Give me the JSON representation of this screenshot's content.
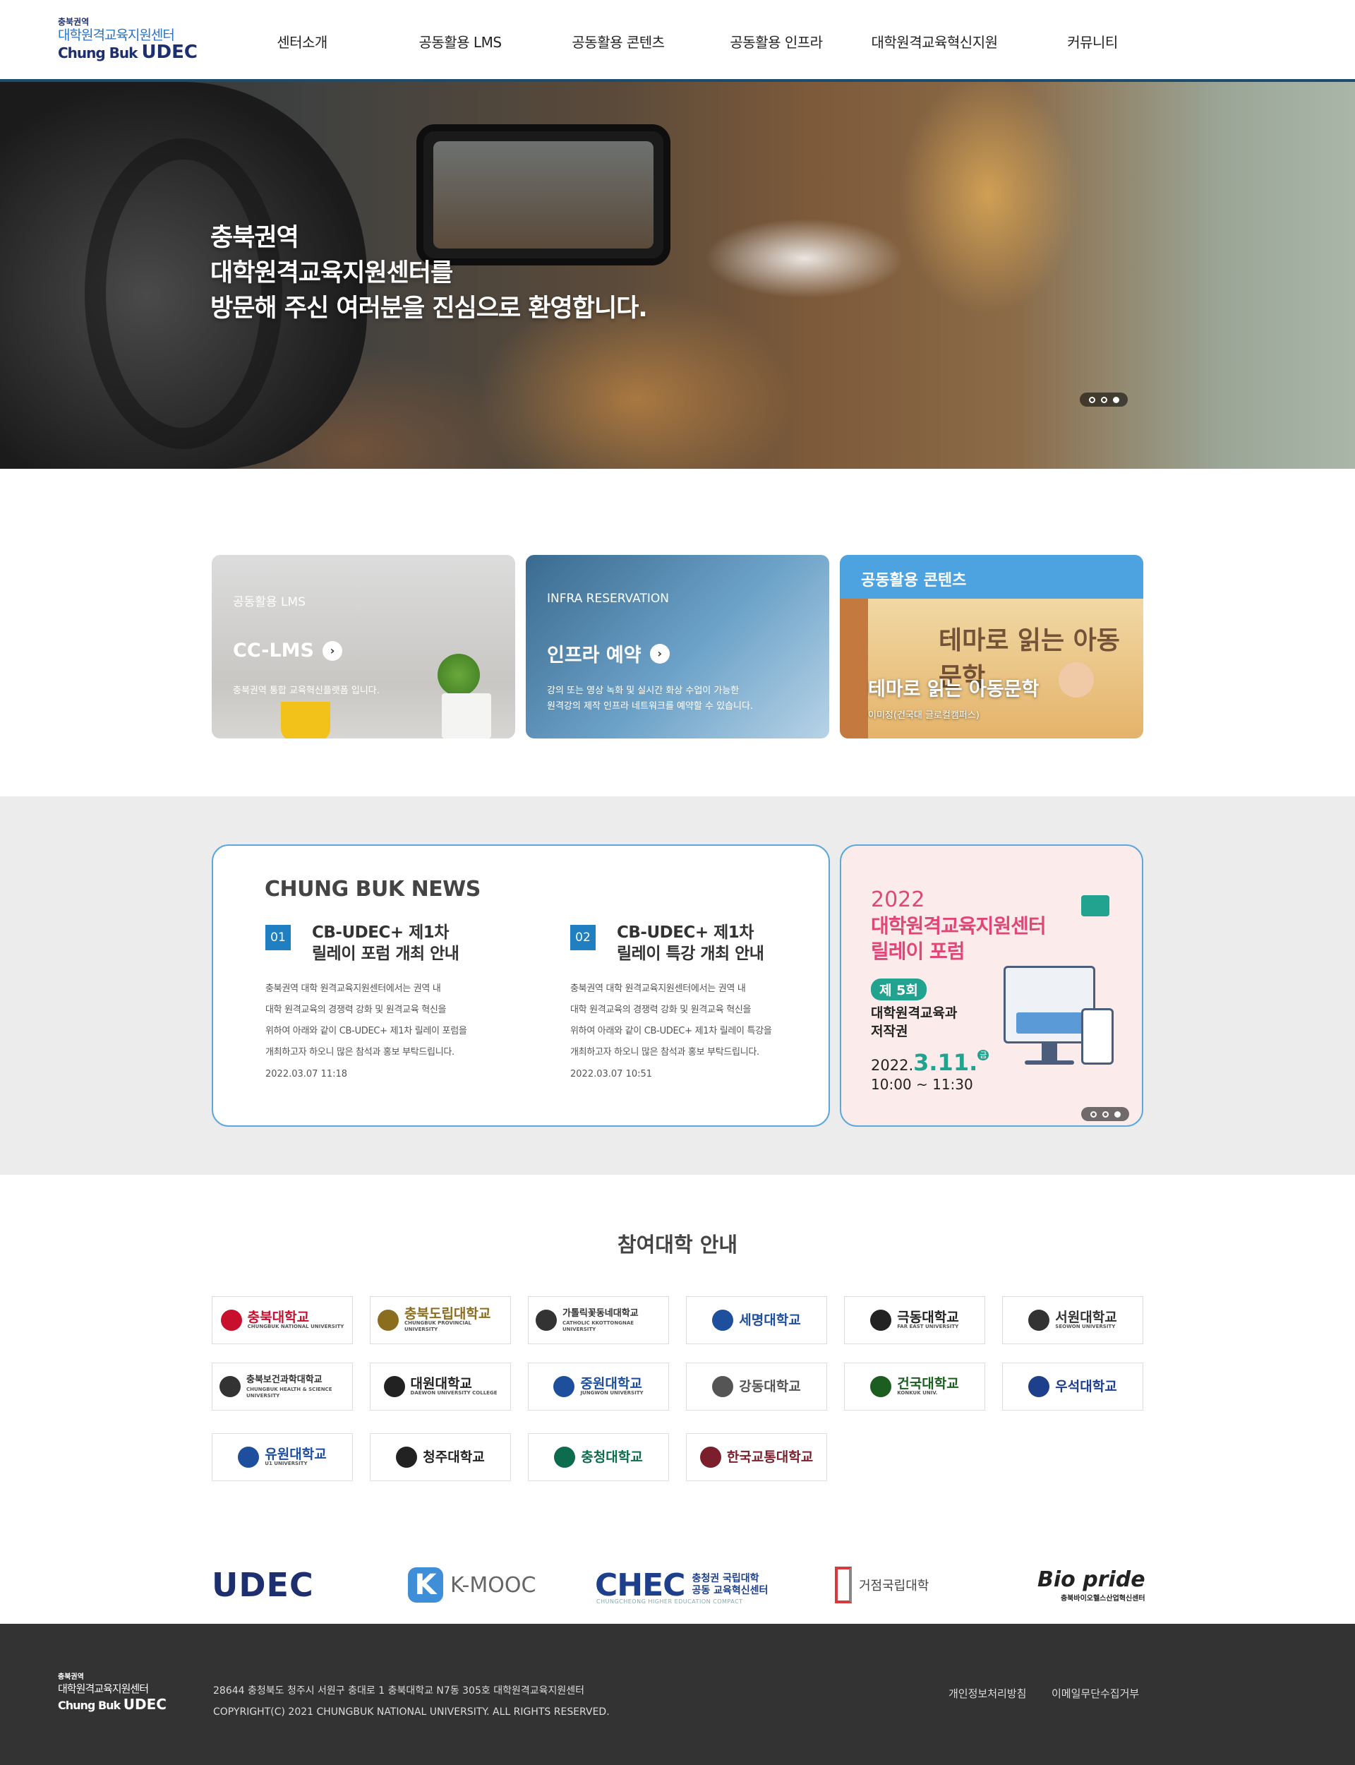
{
  "header": {
    "logo": {
      "line1": "충북권역",
      "line2": "대학원격교육지원센터",
      "line3_a": "Chung Buk",
      "line3_b": "UDEC"
    },
    "nav": [
      "센터소개",
      "공동활용 LMS",
      "공동활용 콘텐츠",
      "공동활용 인프라",
      "대학원격교육혁신지원",
      "커뮤니티"
    ]
  },
  "hero": {
    "title_lines": [
      "충북권역",
      "대학원격교육지원센터를",
      "방문해 주신 여러분을 진심으로 환영합니다."
    ],
    "slide_count": 3,
    "active_slide": 3
  },
  "cards": {
    "lms": {
      "eyebrow": "공동활용 LMS",
      "title": "CC-LMS",
      "desc": "충북권역 통합 교육혁신플랫폼 입니다."
    },
    "infra": {
      "eyebrow": "INFRA RESERVATION",
      "title": "인프라 예약",
      "desc_lines": [
        "강의 또는 영상 녹화 및 실시간 화상 수업이 가능한",
        "원격강의 제작 인프라 네트워크를 예약할 수 있습니다."
      ]
    },
    "content": {
      "header": "공동활용 콘텐츠",
      "poster_text": "테마로 읽는 아동문학",
      "title": "테마로 읽는 아동문학",
      "author": "이미정(건국대 글로컬캠퍼스)"
    }
  },
  "news": {
    "heading": "CHUNG BUK NEWS",
    "items": [
      {
        "num": "01",
        "title_lines": [
          "CB-UDEC+ 제1차",
          "릴레이 포럼 개최 안내"
        ],
        "body_lines": [
          "충북권역 대학 원격교육지원센터에서는 권역 내",
          "대학 원격교육의 경쟁력 강화 및 원격교육 혁신을",
          "위하여 아래와 같이 CB-UDEC+ 제1차 릴레이 포럼을",
          "개최하고자 하오니 많은 참석과 홍보 부탁드립니다."
        ],
        "date": "2022.03.07 11:18"
      },
      {
        "num": "02",
        "title_lines": [
          "CB-UDEC+ 제1차",
          "릴레이 특강 개최 안내"
        ],
        "body_lines": [
          "충북권역 대학 원격교육지원센터에서는 권역 내",
          "대학 원격교육의 경쟁력 강화 및 원격교육 혁신을",
          "위하여 아래와 같이 CB-UDEC+ 제1차 릴레이 특강을",
          "개최하고자 하오니 많은 참석과 홍보 부탁드립니다."
        ],
        "date": "2022.03.07 10:51"
      }
    ]
  },
  "poster": {
    "year": "2022",
    "title_lines": [
      "대학원격교육지원센터",
      "릴레이 포럼"
    ],
    "round": "제 5회",
    "sub_lines": [
      "대학원격교육과",
      "저작권"
    ],
    "date_prefix": "2022.",
    "date_main": "3.11.",
    "day": "금",
    "time": "10:00 ~ 11:30",
    "slide_count": 3,
    "active_slide": 3
  },
  "universities": {
    "heading": "참여대학 안내",
    "items": [
      {
        "name": "충북대학교",
        "sub": "CHUNGBUK NATIONAL UNIVERSITY",
        "color": "#c8102e"
      },
      {
        "name": "충북도립대학교",
        "sub": "CHUNGBUK PROVINCIAL UNIVERSITY",
        "color": "#8a6d1f"
      },
      {
        "name": "가톨릭꽃동네대학교",
        "sub": "CATHOLIC KKOTTONGNAE UNIVERSITY",
        "color": "#333333"
      },
      {
        "name": "세명대학교",
        "sub": "",
        "color": "#1d4f9c"
      },
      {
        "name": "극동대학교",
        "sub": "FAR EAST UNIVERSITY",
        "color": "#222222"
      },
      {
        "name": "서원대학교",
        "sub": "SEOWON UNIVERSITY",
        "color": "#333333"
      },
      {
        "name": "충북보건과학대학교",
        "sub": "CHUNGBUK HEALTH & SCIENCE UNIVERSITY",
        "color": "#333333"
      },
      {
        "name": "대원대학교",
        "sub": "DAEWON UNIVERSITY COLLEGE",
        "color": "#222222"
      },
      {
        "name": "중원대학교",
        "sub": "JUNGWON UNIVERSITY",
        "color": "#1d4f9c"
      },
      {
        "name": "강동대학교",
        "sub": "",
        "color": "#555555"
      },
      {
        "name": "건국대학교",
        "sub": "KONKUK UNIV.",
        "color": "#ffffff"
      },
      {
        "name": "우석대학교",
        "sub": "",
        "color": "#1d3f8c"
      },
      {
        "name": "유원대학교",
        "sub": "U1 UNIVERSITY",
        "color": "#1d4f9c"
      },
      {
        "name": "청주대학교",
        "sub": "",
        "color": "#222222"
      },
      {
        "name": "충청대학교",
        "sub": "",
        "color": "#0d6b4e"
      },
      {
        "name": "한국교통대학교",
        "sub": "",
        "color": "#7a1f2b"
      }
    ]
  },
  "partners": {
    "udec": "UDEC",
    "kmooc": "K-MOOC",
    "chec_main": "CHEC",
    "chec_kr1": "충청권 국립대학",
    "chec_kr2": "공동 교육혁신센터",
    "chec_en": "CHUNGCHEONG HIGHER EDUCATION COMPACT",
    "base": "거점국립대학",
    "bio": "Bio pride",
    "bio_sub": "충북바이오헬스산업혁신센터"
  },
  "footer": {
    "logo": {
      "line1": "충북권역",
      "line2": "대학원격교육지원센터",
      "line3_a": "Chung Buk",
      "line3_b": "UDEC"
    },
    "address": "28644 충청북도 청주시 서원구 충대로 1 충북대학교 N7동 305호 대학원격교육지원센터",
    "copyright": "COPYRIGHT(C) 2021 CHUNGBUK NATIONAL UNIVERSITY. ALL RIGHTS RESERVED.",
    "links": [
      "개인정보처리방침",
      "이메일무단수집거부"
    ]
  }
}
